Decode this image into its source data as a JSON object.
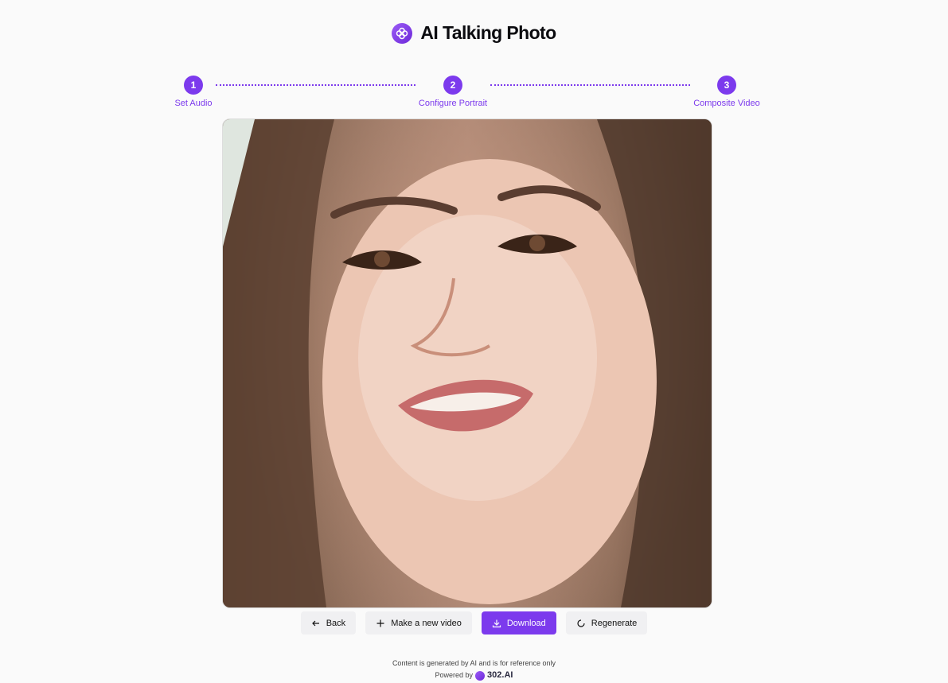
{
  "app": {
    "title": "AI Talking Photo",
    "logo_icon": "clover-icon",
    "accent_color": "#7c3aed"
  },
  "stepper": {
    "steps": [
      {
        "number": "1",
        "label": "Set Audio"
      },
      {
        "number": "2",
        "label": "Configure Portrait"
      },
      {
        "number": "3",
        "label": "Composite Video"
      }
    ],
    "current_step": 3
  },
  "media": {
    "kind": "video-result",
    "alt": "Smiling woman portrait"
  },
  "actions": {
    "back": {
      "label": "Back",
      "icon": "arrow-left-icon"
    },
    "new_video": {
      "label": "Make a new video",
      "icon": "plus-icon"
    },
    "download": {
      "label": "Download",
      "icon": "download-icon"
    },
    "regenerate": {
      "label": "Regenerate",
      "icon": "refresh-icon"
    }
  },
  "footer": {
    "disclaimer": "Content is generated by AI and is for reference only",
    "powered_by": "Powered by",
    "brand": "302.AI"
  }
}
